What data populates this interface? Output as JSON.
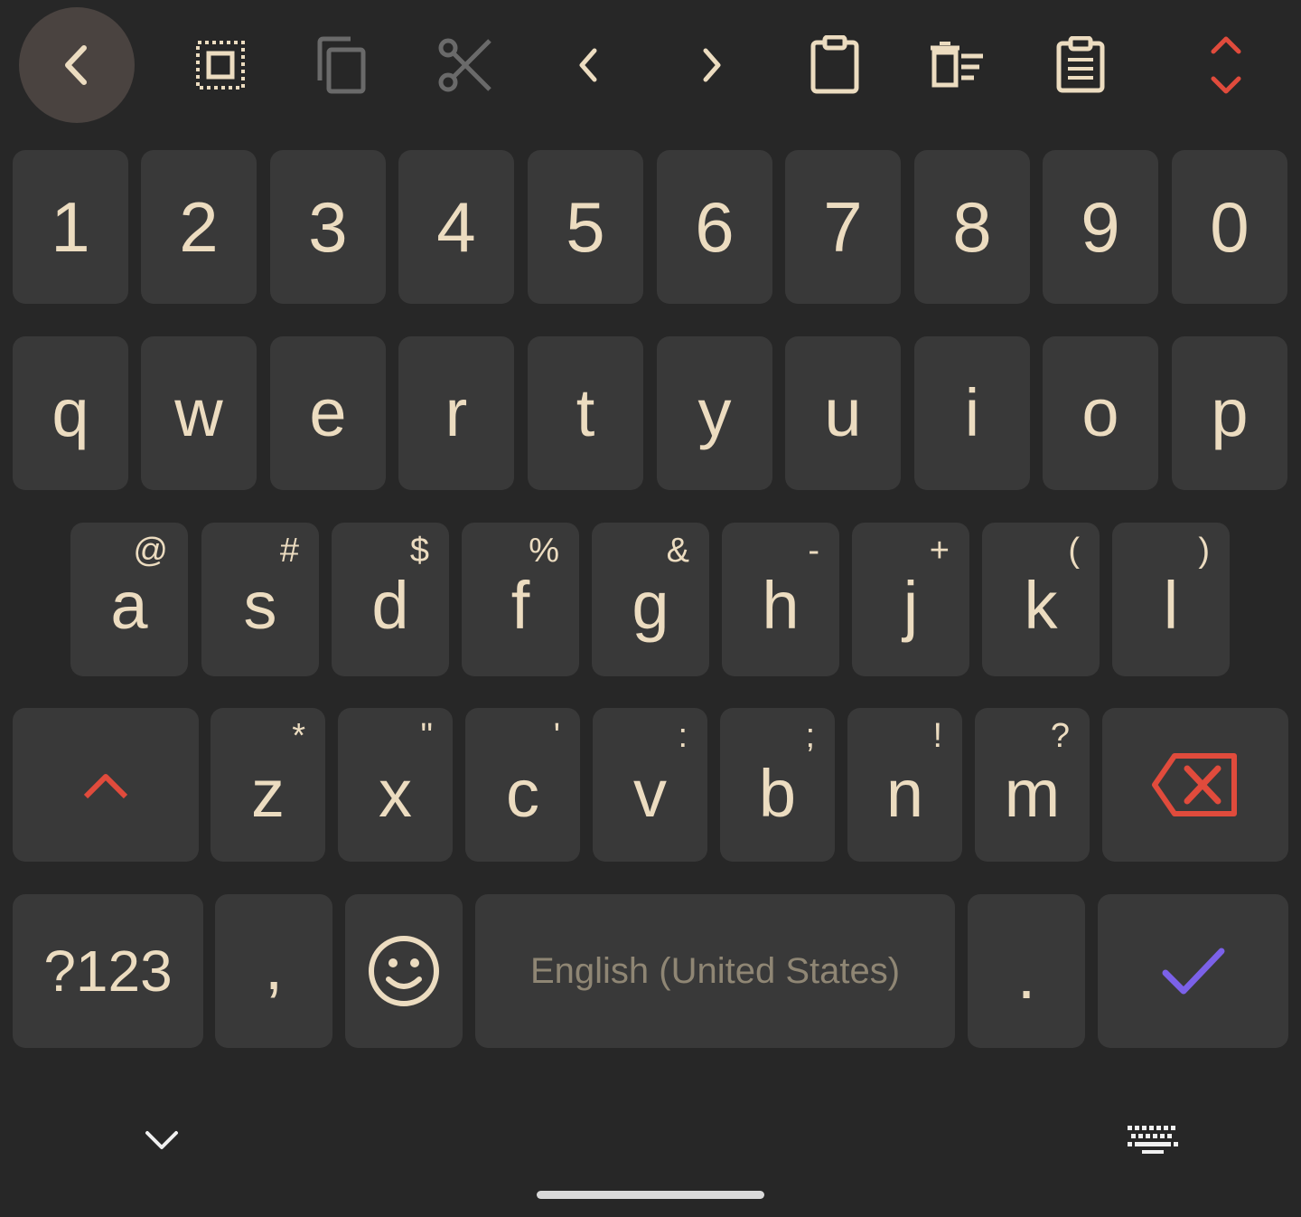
{
  "toolbar": {
    "items": [
      {
        "name": "back-icon",
        "semantic": "chevron-left"
      },
      {
        "name": "select-all-icon",
        "semantic": "select-all"
      },
      {
        "name": "copy-icon",
        "semantic": "copy",
        "state": "disabled"
      },
      {
        "name": "cut-icon",
        "semantic": "scissors",
        "state": "disabled"
      },
      {
        "name": "cursor-left-icon",
        "semantic": "chevron-left"
      },
      {
        "name": "cursor-right-icon",
        "semantic": "chevron-right"
      },
      {
        "name": "paste-icon",
        "semantic": "clipboard"
      },
      {
        "name": "clear-clipboard-icon",
        "semantic": "delete-list"
      },
      {
        "name": "clipboard-history-icon",
        "semantic": "clipboard-text"
      },
      {
        "name": "expand-collapse-icon",
        "semantic": "chevrons-up-down"
      }
    ]
  },
  "keyboard": {
    "number_row": [
      "1",
      "2",
      "3",
      "4",
      "5",
      "6",
      "7",
      "8",
      "9",
      "0"
    ],
    "row_q": [
      "q",
      "w",
      "e",
      "r",
      "t",
      "y",
      "u",
      "i",
      "o",
      "p"
    ],
    "row_a": [
      {
        "key": "a",
        "hint": "@"
      },
      {
        "key": "s",
        "hint": "#"
      },
      {
        "key": "d",
        "hint": "$"
      },
      {
        "key": "f",
        "hint": "%"
      },
      {
        "key": "g",
        "hint": "&"
      },
      {
        "key": "h",
        "hint": "-"
      },
      {
        "key": "j",
        "hint": "+"
      },
      {
        "key": "k",
        "hint": "("
      },
      {
        "key": "l",
        "hint": ")"
      }
    ],
    "row_z": [
      {
        "key": "z",
        "hint": "*"
      },
      {
        "key": "x",
        "hint": "\""
      },
      {
        "key": "c",
        "hint": "'"
      },
      {
        "key": "v",
        "hint": ":"
      },
      {
        "key": "b",
        "hint": ";"
      },
      {
        "key": "n",
        "hint": "!"
      },
      {
        "key": "m",
        "hint": "?"
      }
    ],
    "shift_icon": "chevron-up-icon",
    "backspace_icon": "backspace-icon",
    "bottom_row": {
      "symbols_label": "?123",
      "comma_label": ",",
      "emoji_icon": "smiley-icon",
      "space_label": "English (United States)",
      "period_label": ".",
      "enter_icon": "checkmark-icon"
    }
  },
  "colors": {
    "background": "#272727",
    "key": "#393939",
    "key_text": "#ecdcc0",
    "accent_red": "#e04b3c",
    "accent_purple": "#7b61e8",
    "disabled": "#6a6a6a"
  },
  "nav": {
    "hide_keyboard_icon": "chevron-down-icon",
    "switch_keyboard_icon": "keyboard-icon"
  }
}
